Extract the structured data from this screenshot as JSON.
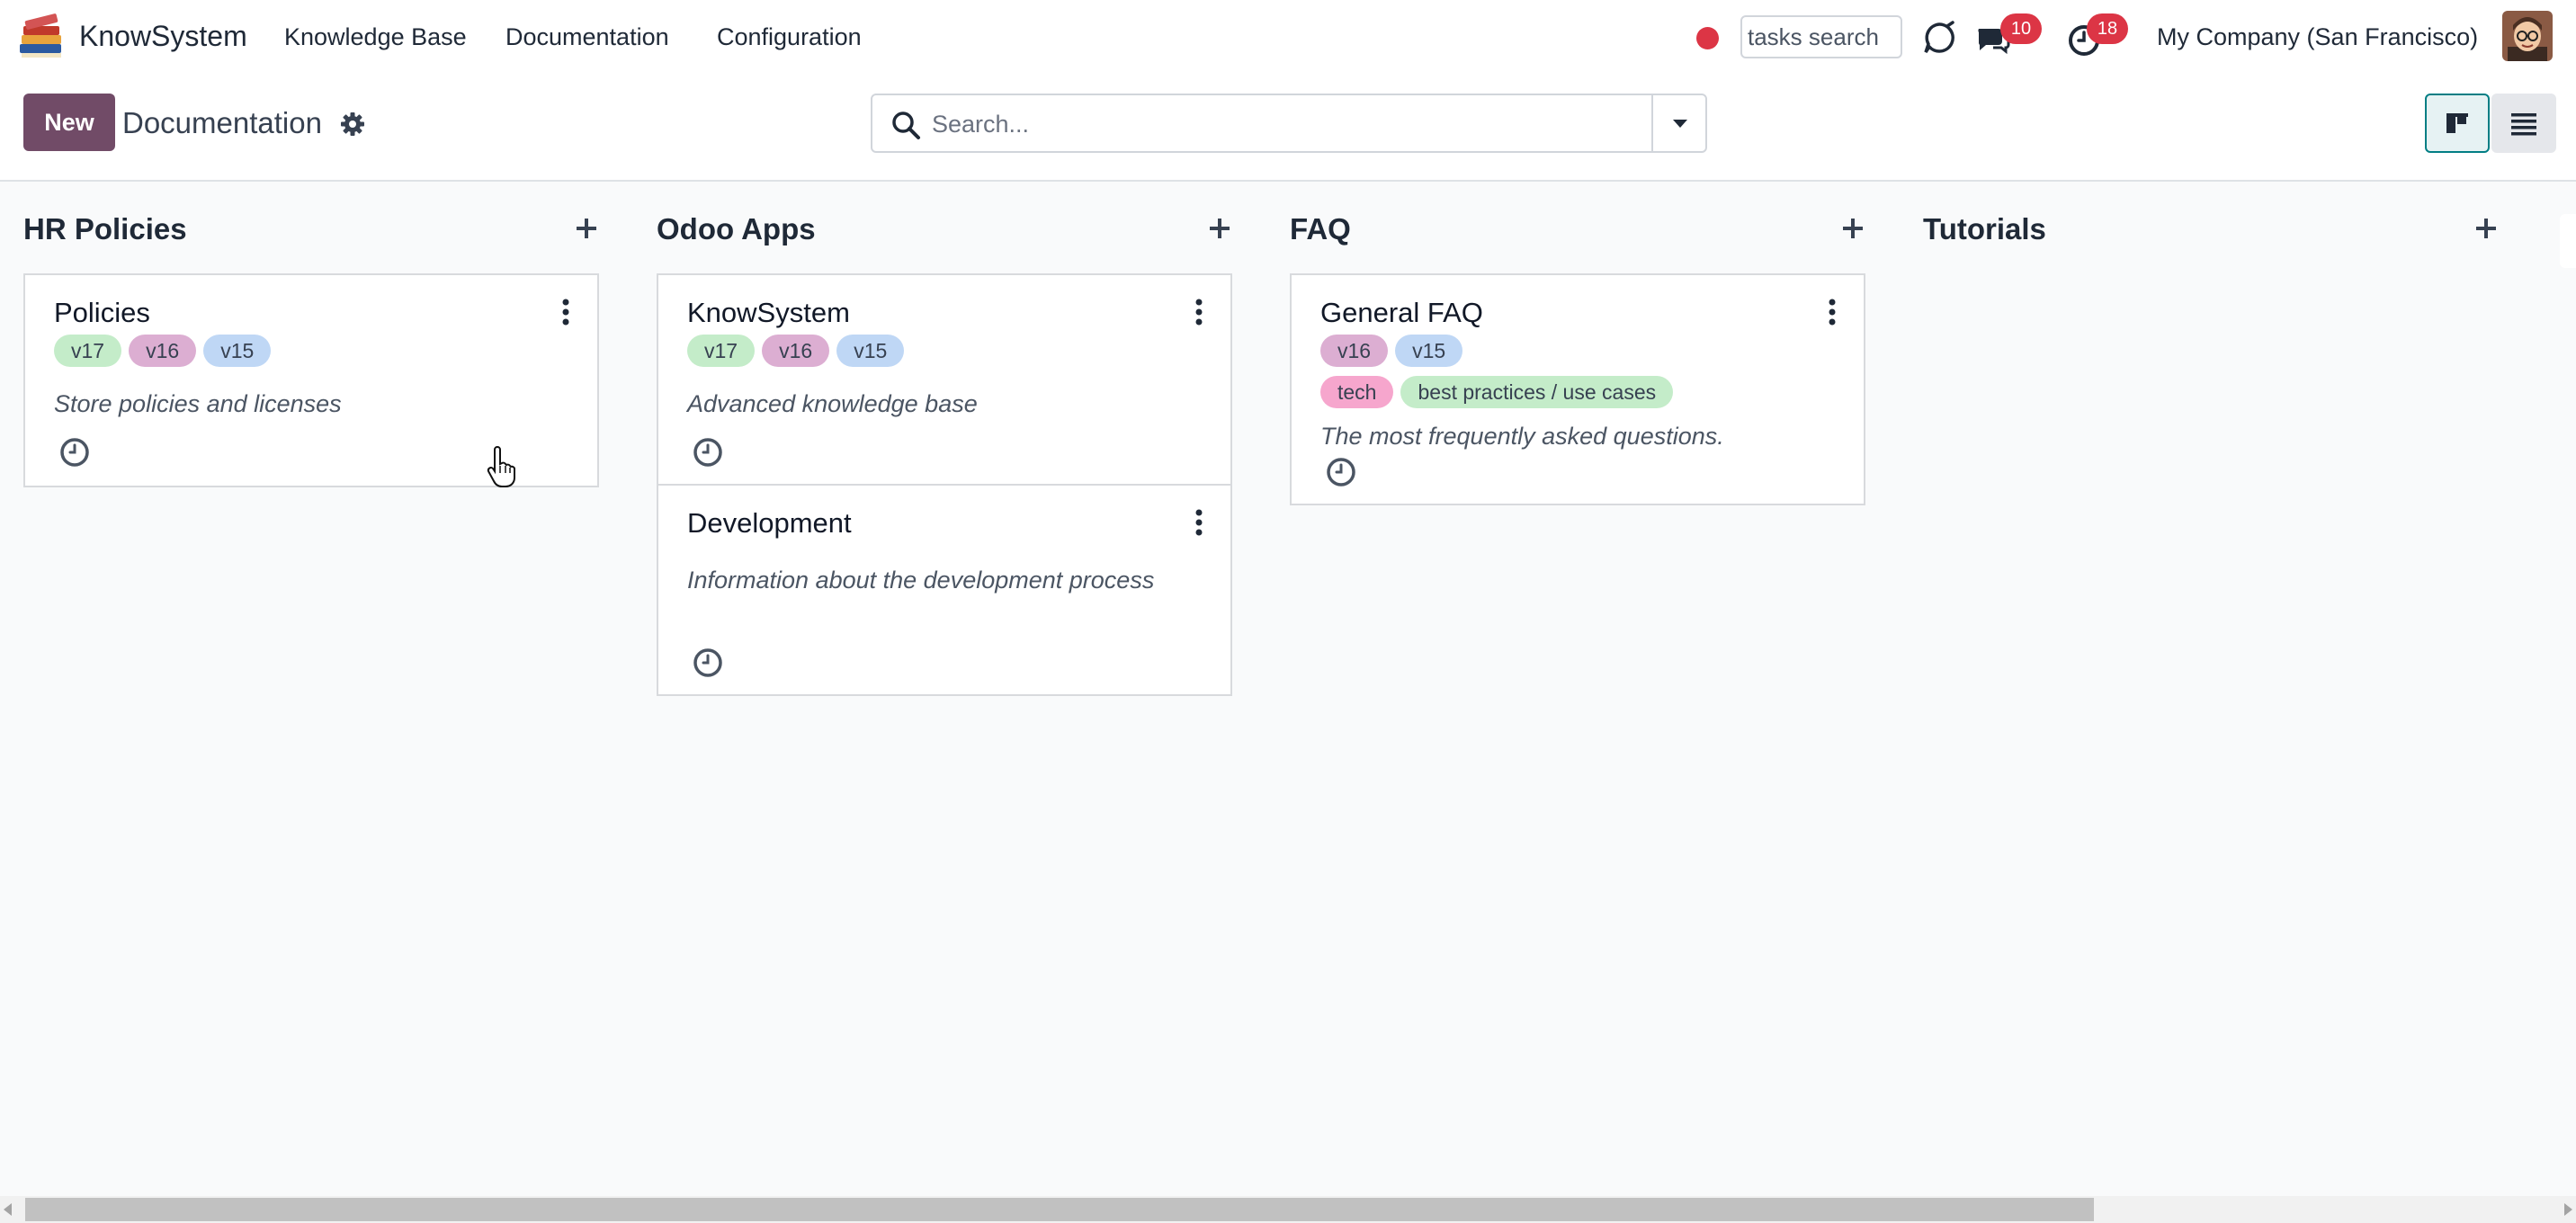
{
  "navbar": {
    "app_name": "KnowSystem",
    "menu": [
      "Knowledge Base",
      "Documentation",
      "Configuration"
    ],
    "tasks_search_value": "tasks search",
    "messages_count": "10",
    "activities_count": "18",
    "company": "My Company (San Francisco)"
  },
  "control": {
    "new_label": "New",
    "breadcrumb": "Documentation",
    "search_placeholder": "Search..."
  },
  "columns": [
    {
      "title": "HR Policies",
      "cards": [
        {
          "title": "Policies",
          "tags": [
            "v17",
            "v16",
            "v15"
          ],
          "description": "Store policies and licenses"
        }
      ]
    },
    {
      "title": "Odoo Apps",
      "cards": [
        {
          "title": "KnowSystem",
          "tags": [
            "v17",
            "v16",
            "v15"
          ],
          "description": "Advanced knowledge base"
        },
        {
          "title": "Development",
          "tags": [],
          "description": "Information about the development process"
        }
      ]
    },
    {
      "title": "FAQ",
      "cards": [
        {
          "title": "General FAQ",
          "tags": [
            "v16",
            "v15"
          ],
          "tags2": [
            "tech",
            "best practices / use cases"
          ],
          "description": "The most frequently asked questions."
        }
      ]
    },
    {
      "title": "Tutorials",
      "cards": []
    }
  ],
  "colors": {
    "primary": "#714b67",
    "accent": "#017e84",
    "badge": "#dc3545",
    "tag_v17": "#c4ecc9",
    "tag_v16": "#dcaed2",
    "tag_v15": "#bfd7f5",
    "tag_tech": "#f6a6cd",
    "tag_best_practices": "#c4ecc9"
  }
}
